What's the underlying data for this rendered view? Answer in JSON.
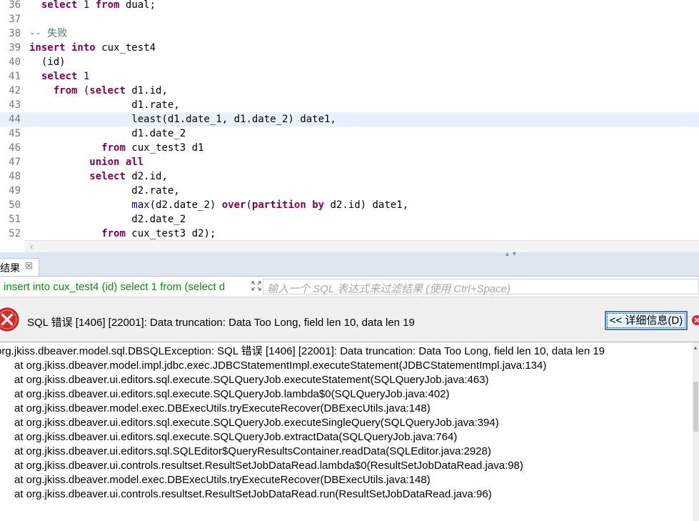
{
  "editor": {
    "current_line": "44",
    "lines": [
      {
        "n": "36",
        "html": "  <span class=\"kw\">select</span> <span class=\"num\">1</span> <span class=\"kw\">from</span> dual;"
      },
      {
        "n": "37",
        "html": ""
      },
      {
        "n": "38",
        "html": "<span class=\"cmt\">-- 失败</span>"
      },
      {
        "n": "39",
        "html": "<span class=\"kw\">insert into</span> cux_test4"
      },
      {
        "n": "40",
        "html": "  (id)"
      },
      {
        "n": "41",
        "html": "  <span class=\"kw\">select</span> <span class=\"num\">1</span>"
      },
      {
        "n": "42",
        "html": "    <span class=\"kw\">from</span> (<span class=\"kw\">select</span> d1.id,"
      },
      {
        "n": "43",
        "html": "                 d1.rate,"
      },
      {
        "n": "44",
        "html": "                 least(d1.date_1, d1.date_2) date1,"
      },
      {
        "n": "45",
        "html": "                 d1.date_2"
      },
      {
        "n": "46",
        "html": "            <span class=\"kw\">from</span> cux_test3 d1"
      },
      {
        "n": "47",
        "html": "          <span class=\"kw\">union all</span>"
      },
      {
        "n": "48",
        "html": "          <span class=\"kw\">select</span> d2.id,"
      },
      {
        "n": "49",
        "html": "                 d2.rate,"
      },
      {
        "n": "50",
        "html": "                 <span class=\"fn\">max</span>(d2.date_2) <span class=\"kw\">over</span>(<span class=\"kw\">partition by</span> d2.id) date1,"
      },
      {
        "n": "51",
        "html": "                 d2.date_2"
      },
      {
        "n": "52",
        "html": "            <span class=\"kw\">from</span> cux_test3 d2);"
      }
    ]
  },
  "results_tab": {
    "label": "结果",
    "close_glyph": "☒"
  },
  "filter": {
    "query_text": "insert into cux_test4 (id) select 1 from (select d",
    "placeholder": "输入一个 SQL 表达式来过滤结果 (使用 Ctrl+Space)"
  },
  "error": {
    "message": "SQL 错误 [1406] [22001]: Data truncation: Data Too Long, field len 10, data len 19",
    "details_button": "<< 详细信息(D)",
    "colors": {
      "icon": "#d9272e",
      "button_border": "#3c7fb1"
    }
  },
  "stacktrace": {
    "first": "org.jkiss.dbeaver.model.sql.DBSQLException: SQL 错误 [1406] [22001]: Data truncation: Data Too Long, field len 10, data len 19",
    "frames": [
      "at org.jkiss.dbeaver.model.impl.jdbc.exec.JDBCStatementImpl.executeStatement(JDBCStatementImpl.java:134)",
      "at org.jkiss.dbeaver.ui.editors.sql.execute.SQLQueryJob.executeStatement(SQLQueryJob.java:463)",
      "at org.jkiss.dbeaver.ui.editors.sql.execute.SQLQueryJob.lambda$0(SQLQueryJob.java:402)",
      "at org.jkiss.dbeaver.model.exec.DBExecUtils.tryExecuteRecover(DBExecUtils.java:148)",
      "at org.jkiss.dbeaver.ui.editors.sql.execute.SQLQueryJob.executeSingleQuery(SQLQueryJob.java:394)",
      "at org.jkiss.dbeaver.ui.editors.sql.execute.SQLQueryJob.extractData(SQLQueryJob.java:764)",
      "at org.jkiss.dbeaver.ui.editors.sql.SQLEditor$QueryResultsContainer.readData(SQLEditor.java:2928)",
      "at org.jkiss.dbeaver.ui.controls.resultset.ResultSetJobDataRead.lambda$0(ResultSetJobDataRead.java:98)",
      "at org.jkiss.dbeaver.model.exec.DBExecUtils.tryExecuteRecover(DBExecUtils.java:148)",
      "at org.jkiss.dbeaver.ui.controls.resultset.ResultSetJobDataRead.run(ResultSetJobDataRead.java:96)"
    ]
  }
}
